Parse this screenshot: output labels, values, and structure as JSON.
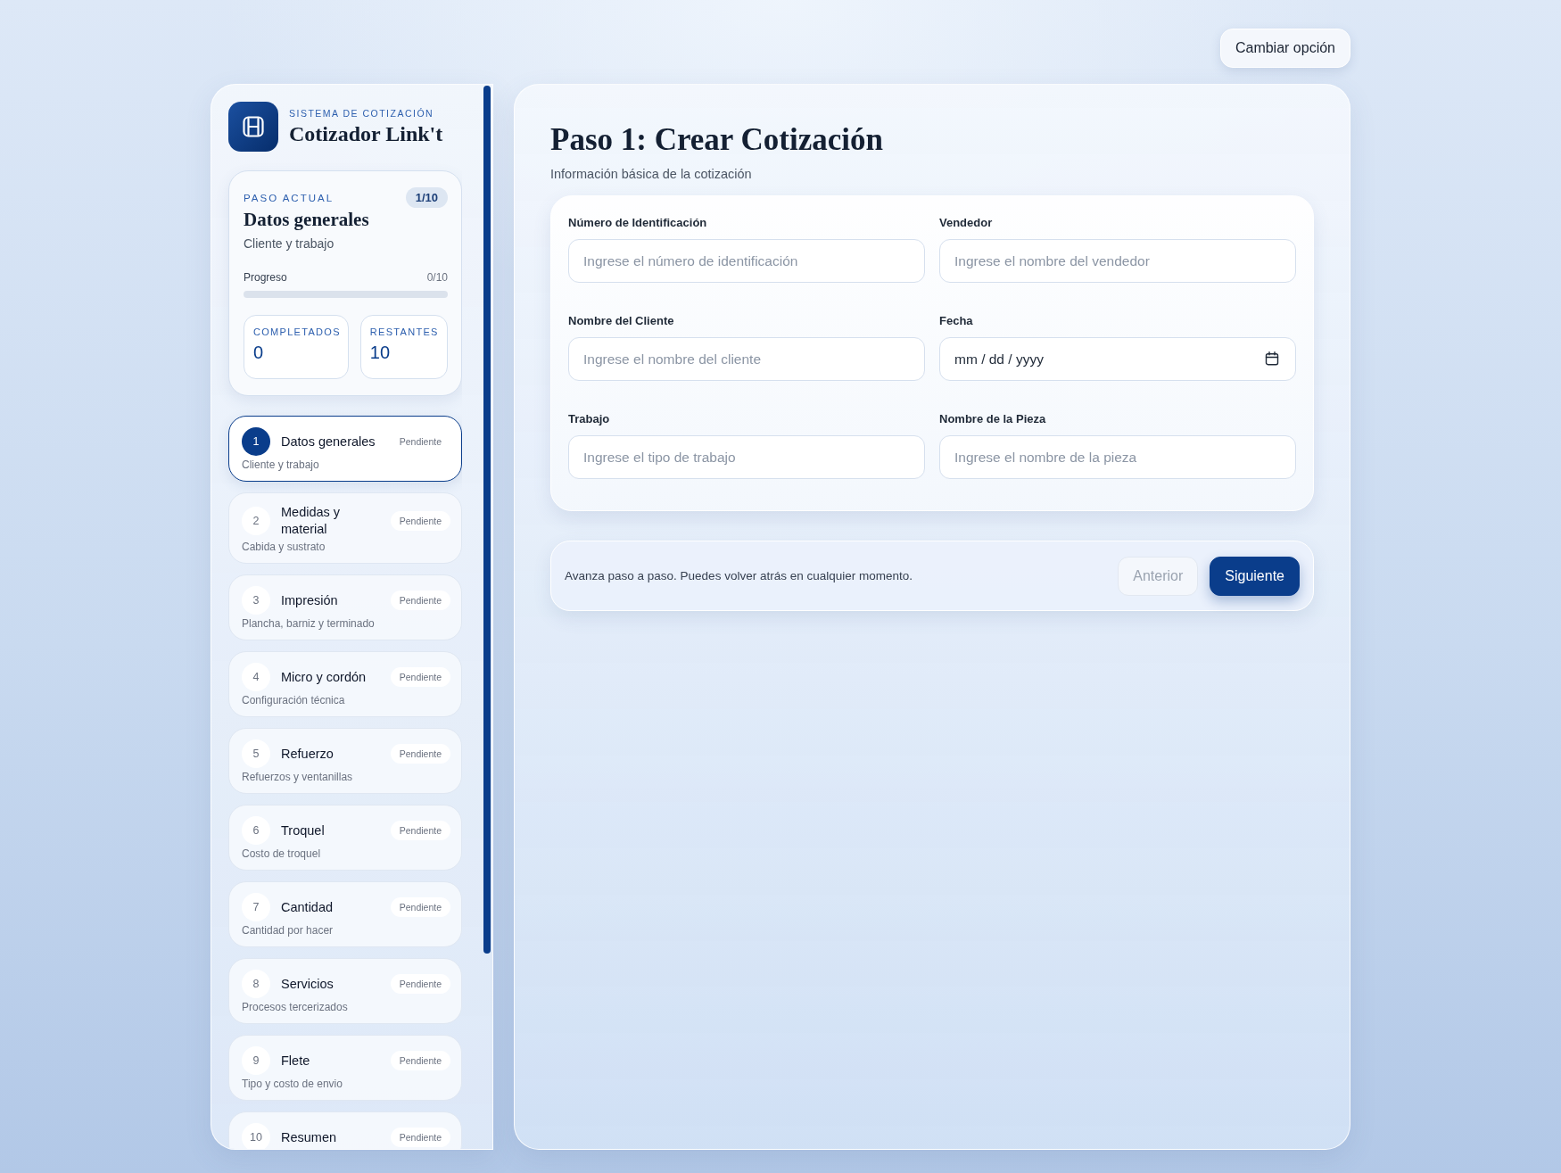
{
  "top_bar": {
    "change_option_button": "Cambiar opción"
  },
  "sidebar": {
    "brand": {
      "eyebrow": "SISTEMA DE COTIZACIÓN",
      "title": "Cotizador Link't"
    },
    "current_step": {
      "label": "PASO ACTUAL",
      "counter": "1/10",
      "title": "Datos generales",
      "subtitle": "Cliente y trabajo",
      "progress": {
        "label": "Progreso",
        "reading": "0/10",
        "level": 0
      },
      "stats": [
        {
          "label": "COMPLETADOS",
          "value": "0"
        },
        {
          "label": "RESTANTES",
          "value": "10"
        }
      ]
    },
    "steps": [
      {
        "number": "1",
        "title": "Datos generales",
        "subtitle": "Cliente y trabajo",
        "status": "Pendiente",
        "selected": true
      },
      {
        "number": "2",
        "title": "Medidas y material",
        "subtitle": "Cabida y sustrato",
        "status": "Pendiente",
        "selected": false
      },
      {
        "number": "3",
        "title": "Impresión",
        "subtitle": "Plancha, barniz y terminado",
        "status": "Pendiente",
        "selected": false
      },
      {
        "number": "4",
        "title": "Micro y cordón",
        "subtitle": "Configuración técnica",
        "status": "Pendiente",
        "selected": false
      },
      {
        "number": "5",
        "title": "Refuerzo",
        "subtitle": "Refuerzos y ventanillas",
        "status": "Pendiente",
        "selected": false
      },
      {
        "number": "6",
        "title": "Troquel",
        "subtitle": "Costo de troquel",
        "status": "Pendiente",
        "selected": false
      },
      {
        "number": "7",
        "title": "Cantidad",
        "subtitle": "Cantidad por hacer",
        "status": "Pendiente",
        "selected": false
      },
      {
        "number": "8",
        "title": "Servicios",
        "subtitle": "Procesos tercerizados",
        "status": "Pendiente",
        "selected": false
      },
      {
        "number": "9",
        "title": "Flete",
        "subtitle": "Tipo y costo de envio",
        "status": "Pendiente",
        "selected": false
      },
      {
        "number": "10",
        "title": "Resumen",
        "status": "Pendiente",
        "selected": false
      }
    ]
  },
  "main": {
    "title": "Paso 1: Crear Cotización",
    "subtitle": "Información básica de la cotización",
    "fields": [
      {
        "label": "Número de Identificación",
        "kind": "text",
        "placeholder": "Ingrese el número de identificación"
      },
      {
        "label": "Vendedor",
        "kind": "text",
        "placeholder": "Ingrese el nombre del vendedor"
      },
      {
        "label": "Nombre del Cliente",
        "kind": "text",
        "placeholder": "Ingrese el nombre del cliente"
      },
      {
        "label": "Fecha",
        "kind": "date",
        "value": "mm / dd / yyyy"
      },
      {
        "label": "Trabajo",
        "kind": "text",
        "placeholder": "Ingrese el tipo de trabajo"
      },
      {
        "label": "Nombre de la Pieza",
        "kind": "text",
        "placeholder": "Ingrese el nombre de la pieza"
      }
    ],
    "footer": {
      "hint": "Avanza paso a paso. Puedes volver atrás en cualquier momento.",
      "buttons": [
        {
          "label": "Anterior",
          "kind": "secondary",
          "disabled": true
        },
        {
          "label": "Siguiente",
          "kind": "primary",
          "disabled": false
        }
      ]
    }
  }
}
